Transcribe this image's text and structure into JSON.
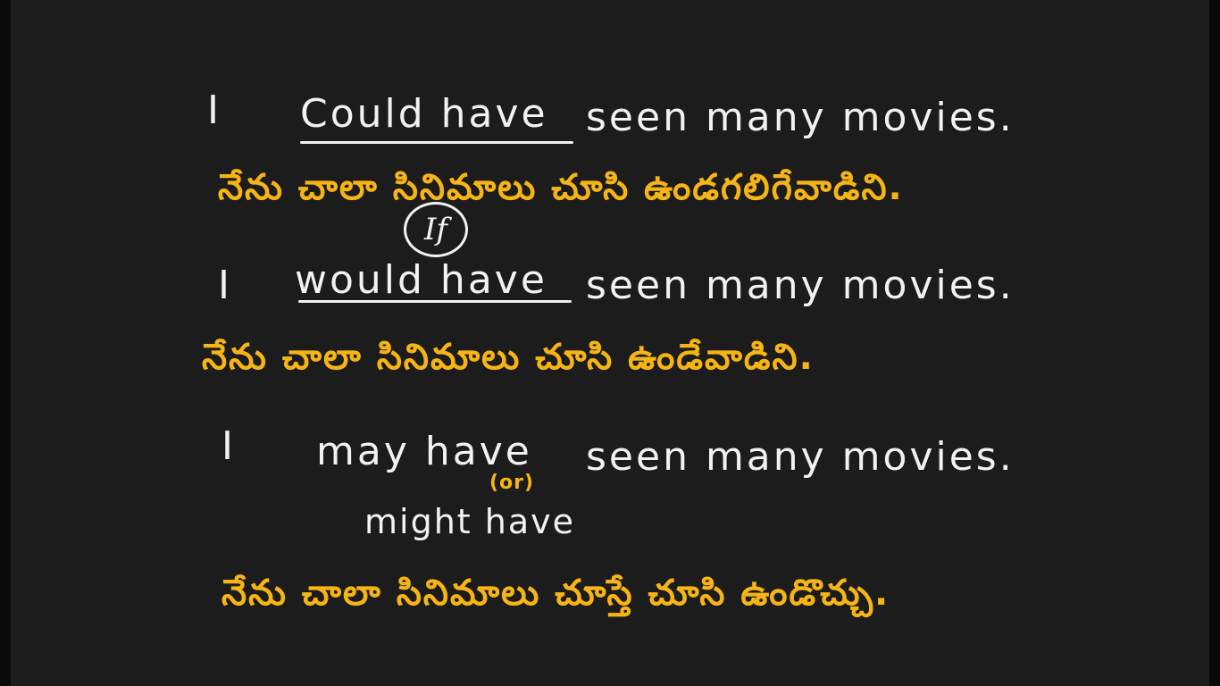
{
  "sentences": [
    {
      "english": {
        "pronoun": "I",
        "modal": "Could have",
        "rest": "seen many movies."
      },
      "telugu": "నేను చాలా సినిమాలు చూసి ఉండగలిగేవాడిని."
    },
    {
      "annotation": "If",
      "english": {
        "pronoun": "I",
        "modal": "would have",
        "rest": "seen many movies."
      },
      "telugu": "నేను చాలా సినిమాలు చూసి ఉండేవాడిని."
    },
    {
      "english": {
        "pronoun": "I",
        "modal": "may have",
        "rest": "seen many movies."
      },
      "alternative": {
        "connector": "(or)",
        "modal": "might have"
      },
      "telugu": "నేను చాలా సినిమాలు చూస్తే చూసి ఉండొచ్చు."
    }
  ],
  "colors": {
    "background": "#1c1c1c",
    "english_text": "#f2f2f2",
    "telugu_text": "#f7b515"
  }
}
